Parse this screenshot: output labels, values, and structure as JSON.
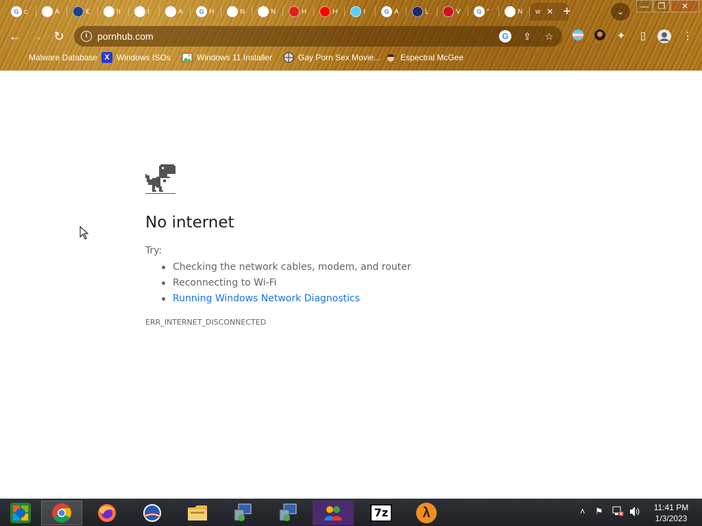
{
  "browser": {
    "tabs": [
      {
        "icon": "google-icon",
        "letter": "c",
        "color": "#ffffff"
      },
      {
        "icon": "chrome-globe-icon",
        "letter": "A",
        "color": "#ffffff"
      },
      {
        "icon": "seal-icon",
        "letter": "€",
        "color": "#1d3f8c"
      },
      {
        "icon": "news-icon",
        "letter": "h",
        "color": "#ffffff"
      },
      {
        "icon": "download-icon",
        "letter": "t",
        "color": "#ffffff"
      },
      {
        "icon": "emblem-icon",
        "letter": "A",
        "color": "#ffffff"
      },
      {
        "icon": "google-icon",
        "letter": "H",
        "color": "#ffffff"
      },
      {
        "icon": "chrome-globe-icon",
        "letter": "N",
        "color": "#ffffff"
      },
      {
        "icon": "chrome-globe-icon",
        "letter": "N",
        "color": "#ffffff"
      },
      {
        "icon": "red-mark-icon",
        "letter": "H",
        "color": "#e02020"
      },
      {
        "icon": "youtube-icon",
        "letter": "H",
        "color": "#ff0000"
      },
      {
        "icon": "flag-icon",
        "letter": "t",
        "color": "#5bcefa"
      },
      {
        "icon": "google-icon",
        "letter": "A",
        "color": "#ffffff"
      },
      {
        "icon": "i24-icon",
        "letter": "L",
        "color": "#1a2a6c"
      },
      {
        "icon": "dv-icon",
        "letter": "V",
        "color": "#d0102a"
      },
      {
        "icon": "google-icon",
        "letter": "\"",
        "color": "#ffffff"
      },
      {
        "icon": "chrome-globe-icon",
        "letter": "N",
        "color": "#ffffff"
      }
    ],
    "active_tab": {
      "letter": "w",
      "close": "✕"
    },
    "new_tab": "+",
    "tab_search": "⌄",
    "window_controls": {
      "minimize": "—",
      "restore": "❐",
      "close": "✕"
    },
    "nav": {
      "back": "←",
      "forward": "→",
      "reload": "↻"
    },
    "omnibox": {
      "info": "i",
      "url": "pornhub.com",
      "google": "G",
      "share": "⇪",
      "bookmark": "☆"
    },
    "toolbar_icons": {
      "extensions": "✦",
      "side_panel": "▯",
      "menu": "⋮"
    },
    "bookmarks": [
      {
        "icon": "bookmark-dot-icon",
        "label": "Malware Database"
      },
      {
        "icon": "x-logo-icon",
        "label": "Windows ISOs",
        "glyph": "X",
        "color": "#2b3bd0"
      },
      {
        "icon": "image-icon",
        "label": "Windows 11 Installer"
      },
      {
        "icon": "globe-icon",
        "label": "Gay Porn Sex Movie..."
      },
      {
        "icon": "avatar-icon",
        "label": "Espectral McGee"
      }
    ]
  },
  "page": {
    "title": "No internet",
    "try_label": "Try:",
    "suggestions": [
      {
        "text": "Checking the network cables, modem, and router",
        "link": false
      },
      {
        "text": "Reconnecting to Wi-Fi",
        "link": false
      },
      {
        "text": "Running Windows Network Diagnostics",
        "link": true
      }
    ],
    "error_code": "ERR_INTERNET_DISCONNECTED"
  },
  "taskbar": {
    "apps": [
      {
        "name": "start-button",
        "glyph": "",
        "color": "#1b6b2a"
      },
      {
        "name": "chrome",
        "glyph": "",
        "color": "#ffffff"
      },
      {
        "name": "firefox",
        "glyph": "",
        "color": "#e25c1c"
      },
      {
        "name": "obama-logo",
        "glyph": "",
        "color": "#1f5fb5"
      },
      {
        "name": "file-explorer",
        "glyph": "",
        "color": "#e9c043"
      },
      {
        "name": "network-tool-1",
        "glyph": "",
        "color": "#7aa7d8"
      },
      {
        "name": "network-tool-2",
        "glyph": "",
        "color": "#7aa7d8"
      },
      {
        "name": "messenger",
        "glyph": "",
        "color": "#5a8be0"
      },
      {
        "name": "7zip",
        "glyph": "7z",
        "color": "#000000"
      },
      {
        "name": "half-life-2",
        "glyph": "λ",
        "color": "#f18f1c"
      }
    ],
    "tray": {
      "chevron": "˄",
      "flag": "⚑",
      "network": "▦",
      "volume": "🔊"
    },
    "clock": {
      "time": "11:41 PM",
      "date": "1/3/2023"
    }
  }
}
